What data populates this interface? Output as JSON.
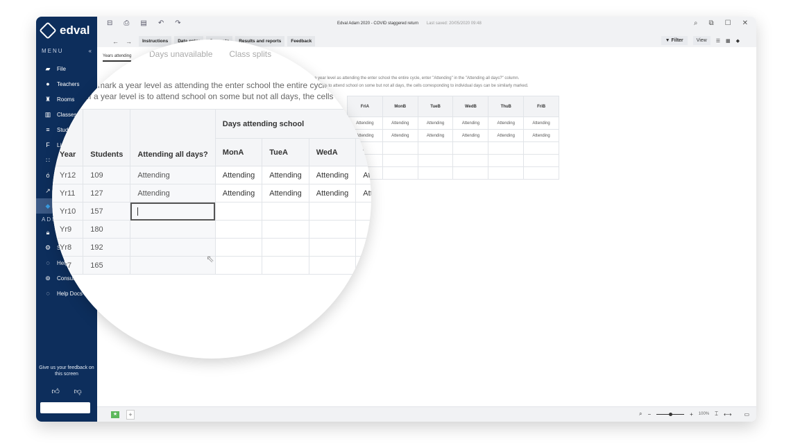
{
  "app": {
    "logo": "edval",
    "document_title": "Edval Adam 2020 - COVID staggered return",
    "last_saved": "Last saved: 20/05/2020 09:48"
  },
  "sidebar": {
    "menu_label": "MENU",
    "collapse_icon": "«",
    "items": [
      {
        "label": "File",
        "icon": "briefcase-icon"
      },
      {
        "label": "Teachers",
        "icon": "person-icon"
      },
      {
        "label": "Rooms",
        "icon": "building-icon"
      },
      {
        "label": "Classes",
        "icon": "book-icon"
      },
      {
        "label": "Students",
        "icon": "graduation-cap-icon"
      },
      {
        "label": "Lines",
        "icon": "lines-icon"
      },
      {
        "label": "",
        "icon": "grid-icon"
      },
      {
        "label": "",
        "icon": "apple-icon"
      },
      {
        "label": "",
        "icon": "chart-icon"
      },
      {
        "label": "",
        "icon": "active-module-icon",
        "active": true
      }
    ],
    "admin_label": "ADMIN",
    "admin_items": [
      {
        "label": "",
        "icon": "lock-icon"
      },
      {
        "label": "Settings",
        "icon": "gear-icon"
      },
      {
        "label": "Help",
        "icon": "chat-icon"
      },
      {
        "label": "Consulting",
        "icon": "consult-icon"
      },
      {
        "label": "Help Docs",
        "icon": "help-docs-icon"
      }
    ],
    "feedback_text": "Give us your feedback on this screen",
    "feedback_input_value": ""
  },
  "toolbar": {
    "tabs": [
      "Instructions",
      "Data entry",
      "Generate",
      "Results and reports",
      "Feedback"
    ],
    "filter_label": "Filter",
    "view_label": "View"
  },
  "subtabs": [
    "Years attending",
    "Days unavailable",
    "Class splits"
  ],
  "instructions": {
    "line1": "To mark a year level as attending the enter school the entire cycle, enter \"Attending\" in the \"Attending all days?\" column.",
    "line2": "If a year level is to attend school on some but not all days, the cells corresponding to individual days can be similarly marked."
  },
  "table": {
    "group_header": "Days attending school",
    "columns": [
      "Year",
      "Students",
      "Attending all days?",
      "MonA",
      "TueA",
      "WedA",
      "ThuA",
      "FriA",
      "MonB",
      "TueB",
      "WedB",
      "ThuB",
      "FriB"
    ],
    "rows": [
      {
        "year": "Yr12",
        "students": "109",
        "all_days": "Attending",
        "days": [
          "Attending",
          "Attending",
          "Attending",
          "Attending",
          "Attending",
          "Attending",
          "Attending",
          "Attending",
          "Attending",
          "Attending"
        ]
      },
      {
        "year": "Yr11",
        "students": "127",
        "all_days": "Attending",
        "days": [
          "Attending",
          "Attending",
          "Attending",
          "Attending",
          "Attending",
          "Attending",
          "Attending",
          "Attending",
          "Attending",
          "Attending"
        ]
      },
      {
        "year": "Yr10",
        "students": "157",
        "all_days": "",
        "days": [
          "",
          "",
          "",
          "",
          "",
          "",
          "",
          "",
          "",
          ""
        ]
      },
      {
        "year": "Yr9",
        "students": "180",
        "all_days": "",
        "days": [
          "",
          "",
          "",
          "",
          "",
          "",
          "",
          "",
          "",
          ""
        ]
      },
      {
        "year": "Yr8",
        "students": "192",
        "all_days": "",
        "days": [
          "",
          "",
          "",
          "",
          "",
          "",
          "",
          "",
          "",
          ""
        ]
      },
      {
        "year": "Yr7",
        "students": "165",
        "all_days": "",
        "days": [
          "",
          "",
          "",
          "",
          "",
          "",
          "",
          "",
          "",
          ""
        ]
      }
    ]
  },
  "statusbar": {
    "zoom_percent": "100%"
  }
}
